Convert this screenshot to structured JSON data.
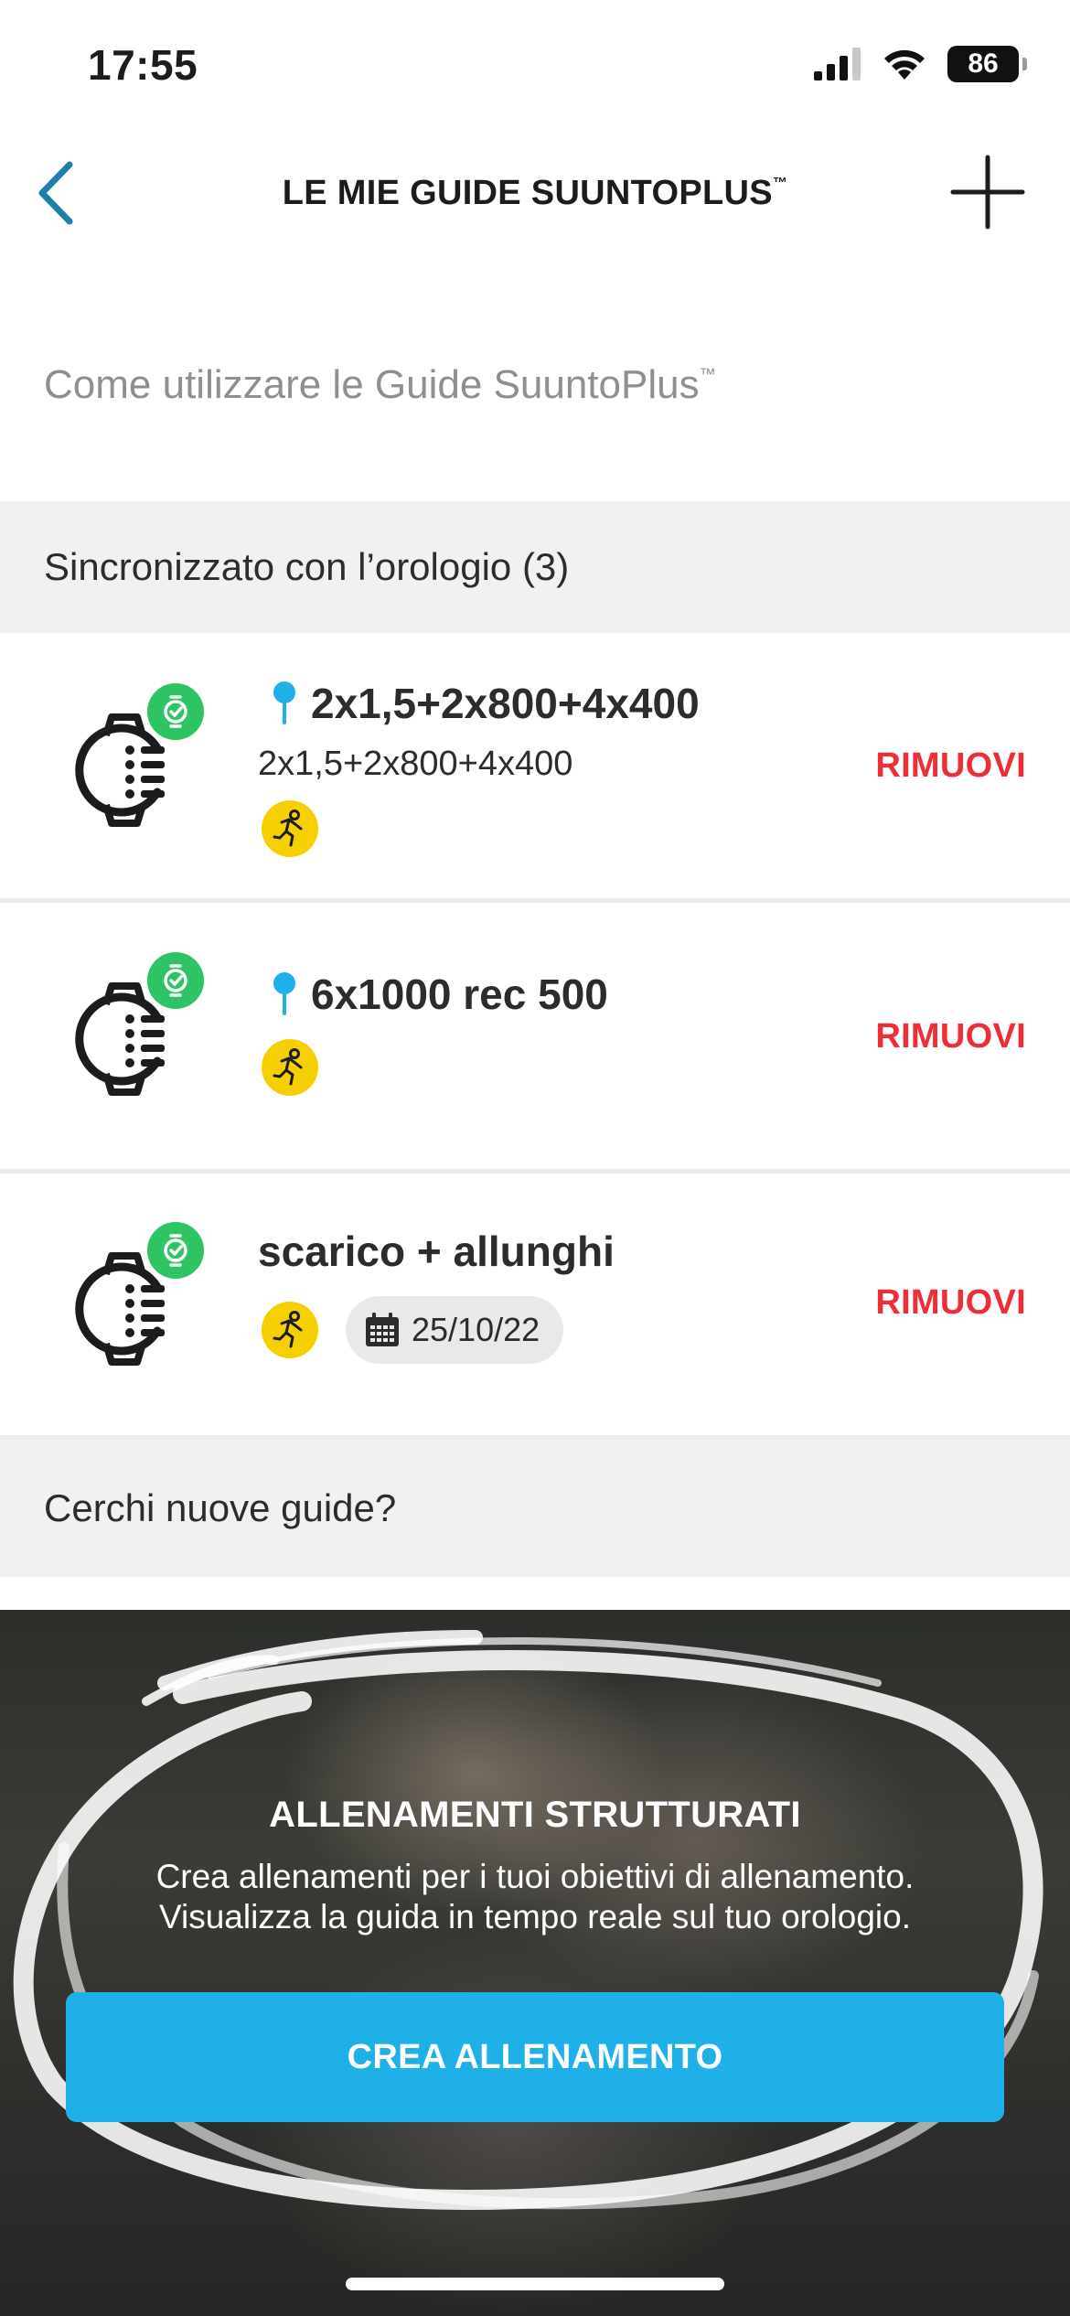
{
  "status_bar": {
    "time": "17:55",
    "battery": "86"
  },
  "header": {
    "title": "LE MIE GUIDE SUUNTOPLUS",
    "title_mark": "™"
  },
  "howto": {
    "label": "Come utilizzare le Guide SuuntoPlus",
    "mark": "™"
  },
  "synced_section": {
    "label": "Sincronizzato con l’orologio (3)"
  },
  "guides": [
    {
      "title": "2x1,5+2x800+4x400",
      "subtitle": "2x1,5+2x800+4x400",
      "pinned": true,
      "sport": "run-icon",
      "remove_label": "RIMUOVI"
    },
    {
      "title": "6x1000 rec 500",
      "subtitle": "",
      "pinned": true,
      "sport": "run-icon",
      "remove_label": "RIMUOVI"
    },
    {
      "title": "scarico + allunghi",
      "subtitle": "",
      "pinned": false,
      "sport": "run-icon",
      "date": "25/10/22",
      "remove_label": "RIMUOVI"
    }
  ],
  "search_section": {
    "label": "Cerchi nuove guide?"
  },
  "promo": {
    "title": "ALLENAMENTI STRUTTURATI",
    "line1": "Crea allenamenti per i tuoi obiettivi di allenamento.",
    "line2": "Visualizza la guida in tempo reale sul tuo orologio.",
    "button_label": "CREA ALLENAMENTO"
  },
  "colors": {
    "accent_blue": "#1fb0e8",
    "remove_red": "#ee2e35",
    "synced_green": "#2ec463",
    "sport_yellow": "#f5d000",
    "back_arrow": "#1f7fa8"
  }
}
